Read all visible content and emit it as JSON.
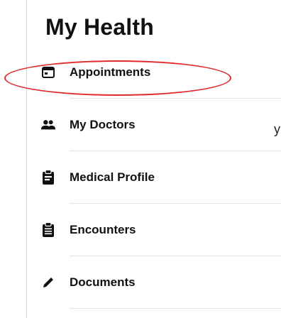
{
  "page": {
    "title": "My Health",
    "left_edge_text": "y"
  },
  "menu": {
    "items": [
      {
        "label": "Appointments",
        "icon": "calendar-icon"
      },
      {
        "label": "My Doctors",
        "icon": "people-icon"
      },
      {
        "label": "Medical Profile",
        "icon": "clipboard-badge-icon"
      },
      {
        "label": "Encounters",
        "icon": "clipboard-list-icon"
      },
      {
        "label": "Documents",
        "icon": "pencil-icon"
      }
    ]
  },
  "annotation": {
    "highlight_color": "#e12b2b",
    "highlighted_item": "Appointments"
  }
}
